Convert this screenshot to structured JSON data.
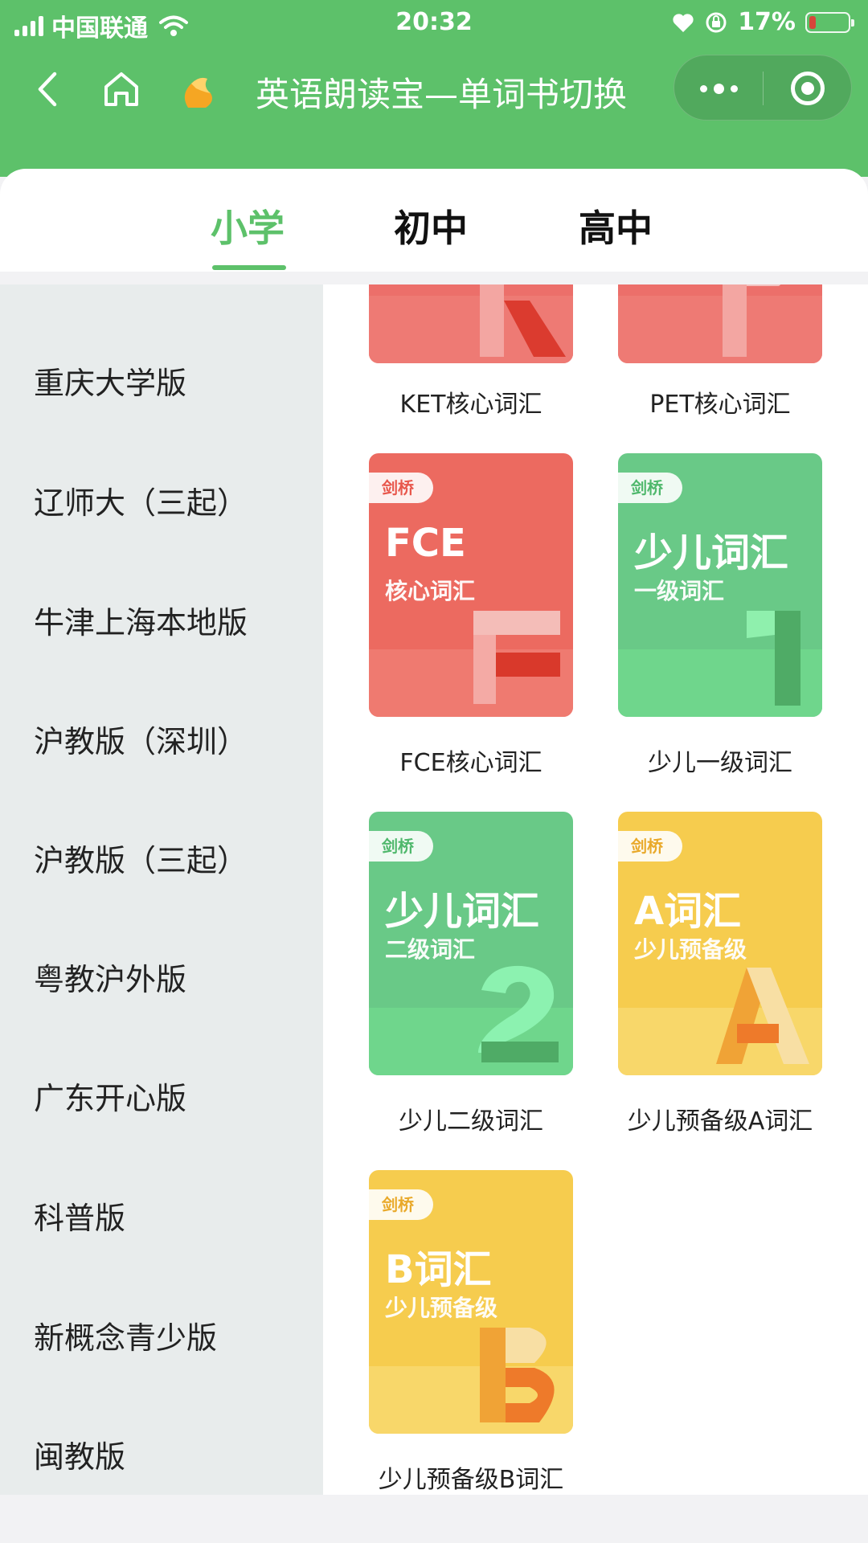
{
  "status_bar": {
    "carrier": "中国联通",
    "time": "20:32",
    "battery": "17%"
  },
  "nav": {
    "title": "英语朗读宝—单词书切换"
  },
  "tabs": [
    {
      "label": "小学",
      "active": true
    },
    {
      "label": "初中"
    },
    {
      "label": "高中"
    }
  ],
  "sidebar": {
    "items": [
      {
        "label": "重庆大学版"
      },
      {
        "label": "辽师大（三起）"
      },
      {
        "label": "牛津上海本地版"
      },
      {
        "label": "沪教版（深圳）"
      },
      {
        "label": "沪教版（三起）"
      },
      {
        "label": "粤教沪外版"
      },
      {
        "label": "广东开心版"
      },
      {
        "label": "科普版"
      },
      {
        "label": "新概念青少版"
      },
      {
        "label": "闽教版"
      }
    ]
  },
  "books": [
    {
      "caption": "KET核心词汇",
      "letter": "K",
      "color": "#ec6f6a"
    },
    {
      "caption": "PET核心词汇",
      "letter": "P",
      "color": "#ec6f6a"
    },
    {
      "caption": "FCE核心词汇",
      "badge": "剑桥",
      "title": "FCE",
      "subtitle": "核心词汇",
      "letter": "F",
      "color": "#ec6a60"
    },
    {
      "caption": "少儿一级词汇",
      "badge": "剑桥",
      "title": "少儿词汇",
      "subtitle": "一级词汇",
      "letter": "1",
      "color": "#69c987"
    },
    {
      "caption": "少儿二级词汇",
      "badge": "剑桥",
      "title": "少儿词汇",
      "subtitle": "二级词汇",
      "letter": "2",
      "color": "#69c987"
    },
    {
      "caption": "少儿预备级A词汇",
      "badge": "剑桥",
      "title": "A词汇",
      "subtitle": "少儿预备级",
      "letter": "A",
      "color": "#f6cc4e"
    },
    {
      "caption": "少儿预备级B词汇",
      "badge": "剑桥",
      "title": "B词汇",
      "subtitle": "少儿预备级",
      "letter": "B",
      "color": "#f6cc4e"
    }
  ]
}
